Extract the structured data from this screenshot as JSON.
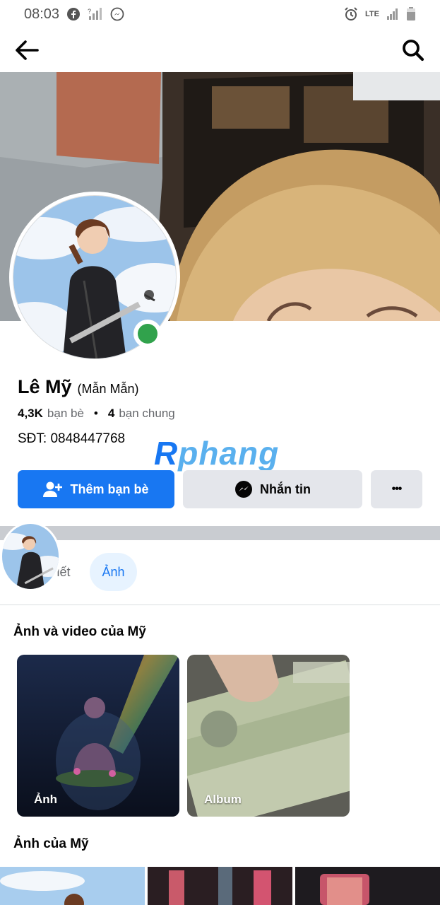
{
  "status_bar": {
    "time": "08:03",
    "network": "LTE",
    "icons": [
      "facebook-icon",
      "no-signal-icon",
      "messenger-icon",
      "alarm-icon",
      "signal-icon",
      "battery-icon"
    ]
  },
  "header": {
    "back_icon": "arrow-left-icon",
    "search_icon": "search-icon"
  },
  "profile": {
    "name": "Lê Mỹ",
    "nickname": "(Mẫn Mẫn)",
    "friends_count": "4,3K",
    "friends_label": "bạn bè",
    "bullet": "•",
    "mutual_count": "4",
    "mutual_label": "bạn chung",
    "phone": "SĐT: 0848447768",
    "online_color": "#31a24c"
  },
  "watermark": {
    "first": "R",
    "rest": "phang"
  },
  "actions": {
    "add_friend": "Thêm bạn bè",
    "message": "Nhắn tin",
    "more": "•••"
  },
  "tabs": [
    {
      "label": "iết"
    },
    {
      "label": "Ảnh",
      "active": true
    }
  ],
  "sections": {
    "photos_videos_title": "Ảnh và video của Mỹ",
    "photos_title": "Ảnh của Mỹ"
  },
  "cards": [
    {
      "label": "Ảnh"
    },
    {
      "label": "Album"
    }
  ],
  "colors": {
    "accent": "#1877f2",
    "button_gray": "#e4e6eb",
    "tab_active_bg": "#e7f3ff"
  }
}
